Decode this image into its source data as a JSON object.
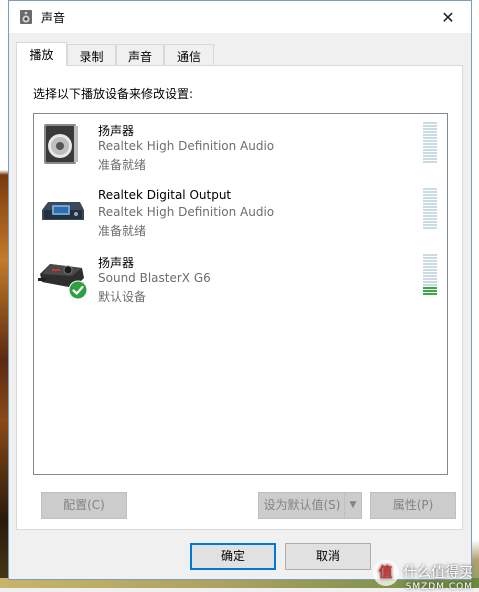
{
  "window": {
    "title": "声音",
    "close_glyph": "✕"
  },
  "tabs": [
    {
      "label": "播放",
      "active": true
    },
    {
      "label": "录制",
      "active": false
    },
    {
      "label": "声音",
      "active": false
    },
    {
      "label": "通信",
      "active": false
    }
  ],
  "panel": {
    "instruction": "选择以下播放设备来修改设置:"
  },
  "devices": [
    {
      "name": "扬声器",
      "description": "Realtek High Definition Audio",
      "status": "准备就绪",
      "icon": "speaker-icon",
      "default": false,
      "level": 0
    },
    {
      "name": "Realtek Digital Output",
      "description": "Realtek High Definition Audio",
      "status": "准备就绪",
      "icon": "digital-output-icon",
      "default": false,
      "level": 0
    },
    {
      "name": "扬声器",
      "description": "Sound BlasterX G6",
      "status": "默认设备",
      "icon": "sound-card-icon",
      "default": true,
      "level": 0.2
    }
  ],
  "buttons": {
    "configure": "配置(C)",
    "set_default": "设为默认值(S)",
    "properties": "属性(P)",
    "ok": "确定",
    "cancel": "取消"
  },
  "watermark": {
    "text": "什么值得买",
    "sub": "SMZDM.COM",
    "icon_text": "值"
  },
  "colors": {
    "meter_off": "#c9dbe3",
    "meter_on": "#3aa844",
    "accent": "#0078d7",
    "check_green": "#2ea043"
  }
}
